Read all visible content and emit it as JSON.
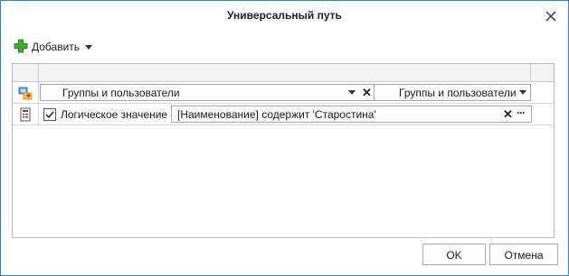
{
  "dialog": {
    "title": "Универсальный путь",
    "close_icon": "close-icon"
  },
  "toolbar": {
    "add_label": "Добавить",
    "add_icon": "green-plus-icon"
  },
  "grid": {
    "rows": [
      {
        "icon": "path-link-icon",
        "field_value": "Группы и пользователи",
        "type_value": "Группы и пользователи"
      },
      {
        "icon": "condition-list-icon",
        "checked": true,
        "check_label": "Логическое значение",
        "expression": "[Наименование] содержит 'Старостина'"
      }
    ]
  },
  "buttons": {
    "ok": "OK",
    "cancel": "Отмена"
  },
  "colors": {
    "window_border": "#2b7fd1",
    "add_icon": "#3dae2b"
  }
}
